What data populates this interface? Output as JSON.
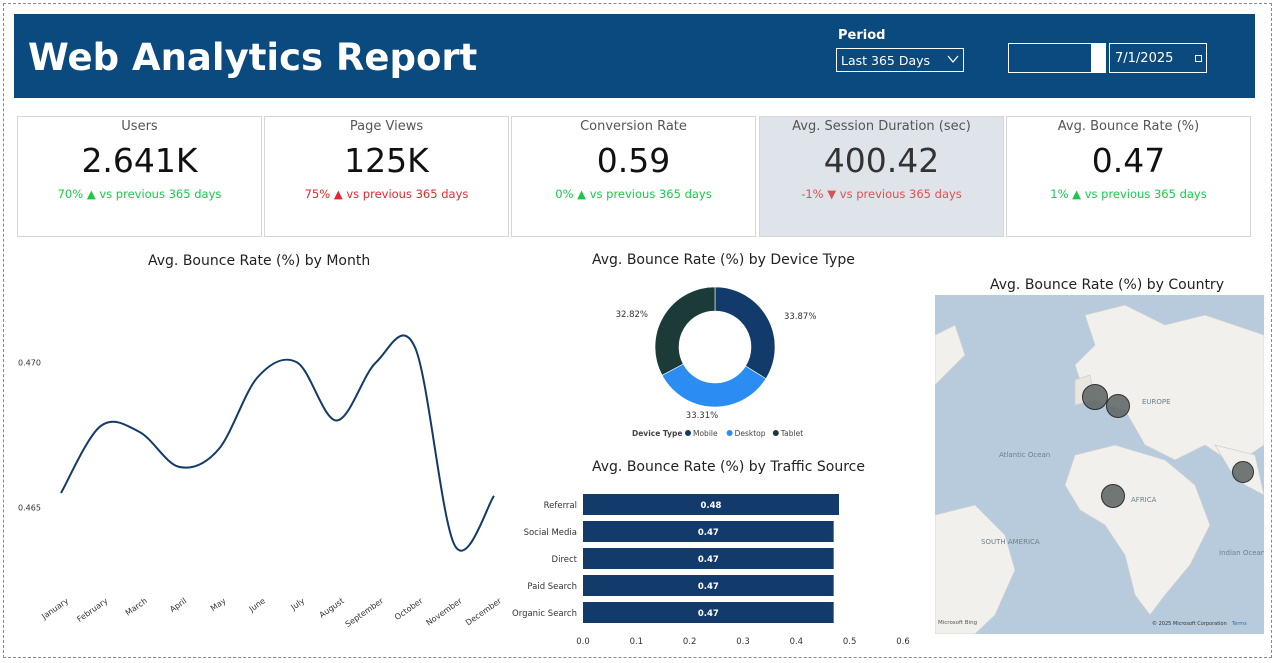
{
  "header": {
    "title": "Web Analytics Report",
    "period_label": "Period",
    "period_selected": "Last 365 Days",
    "date_end": "7/1/2025"
  },
  "kpis": [
    {
      "label": "Users",
      "value": "2.641K",
      "pct": "70%",
      "arrow": "▲",
      "compare": "vs previous 365 days",
      "trend": "up"
    },
    {
      "label": "Page Views",
      "value": "125K",
      "pct": "75%",
      "arrow": "▲",
      "compare": "vs previous 365 days",
      "trend": "down"
    },
    {
      "label": "Conversion Rate",
      "value": "0.59",
      "pct": "0%",
      "arrow": "▲",
      "compare": "vs previous 365 days",
      "trend": "up"
    },
    {
      "label": "Avg. Session Duration (sec)",
      "value": "400.42",
      "pct": "-1%",
      "arrow": "▼",
      "compare": "vs previous 365 days",
      "trend": "down"
    },
    {
      "label": "Avg. Bounce Rate (%)",
      "value": "0.47",
      "pct": "1%",
      "arrow": "▲",
      "compare": "vs previous 365 days",
      "trend": "up"
    }
  ],
  "colors": {
    "header_bg": "#0a4a7e",
    "navy": "#123a6b",
    "blue": "#2b8cf2",
    "dark_green": "#1b3a38",
    "up": "#1cc749",
    "down": "#e3282b"
  },
  "chart_data": [
    {
      "type": "line",
      "title": "Avg. Bounce Rate (%) by Month",
      "categories": [
        "January",
        "February",
        "March",
        "April",
        "May",
        "June",
        "July",
        "August",
        "September",
        "October",
        "November",
        "December"
      ],
      "values": [
        0.4655,
        0.4678,
        0.4676,
        0.4664,
        0.467,
        0.4695,
        0.47,
        0.468,
        0.47,
        0.4705,
        0.4637,
        0.4654
      ],
      "yticks": [
        "0.470",
        "0.465"
      ],
      "ylim": [
        0.4625,
        0.4725
      ]
    },
    {
      "type": "pie",
      "title": "Avg. Bounce Rate (%) by Device Type",
      "legend_title": "Device Type",
      "series": [
        {
          "name": "Mobile",
          "value": 33.87,
          "label": "33.87%",
          "color": "#123a6b"
        },
        {
          "name": "Desktop",
          "value": 33.31,
          "label": "33.31%",
          "color": "#2b8cf2"
        },
        {
          "name": "Tablet",
          "value": 32.82,
          "label": "32.82%",
          "color": "#1b3a38"
        }
      ]
    },
    {
      "type": "bar",
      "title": "Avg. Bounce Rate (%) by Traffic Source",
      "categories": [
        "Referral",
        "Social Media",
        "Direct",
        "Paid Search",
        "Organic Search"
      ],
      "values": [
        0.48,
        0.47,
        0.47,
        0.47,
        0.47
      ],
      "data_labels": [
        "0.48",
        "0.47",
        "0.47",
        "0.47",
        "0.47"
      ],
      "xticks": [
        "0.0",
        "0.1",
        "0.2",
        "0.3",
        "0.4",
        "0.5",
        "0.6"
      ],
      "xlim": [
        0,
        0.6
      ]
    }
  ],
  "map": {
    "title": "Avg. Bounce Rate (%) by Country",
    "labels": [
      "EUROPE",
      "Atlantic Ocean",
      "AFRICA",
      "SOUTH AMERICA",
      "Indian Ocean"
    ],
    "copyright": "© 2025 Microsoft Corporation",
    "terms": "Terms",
    "brand": "Microsoft Bing"
  }
}
